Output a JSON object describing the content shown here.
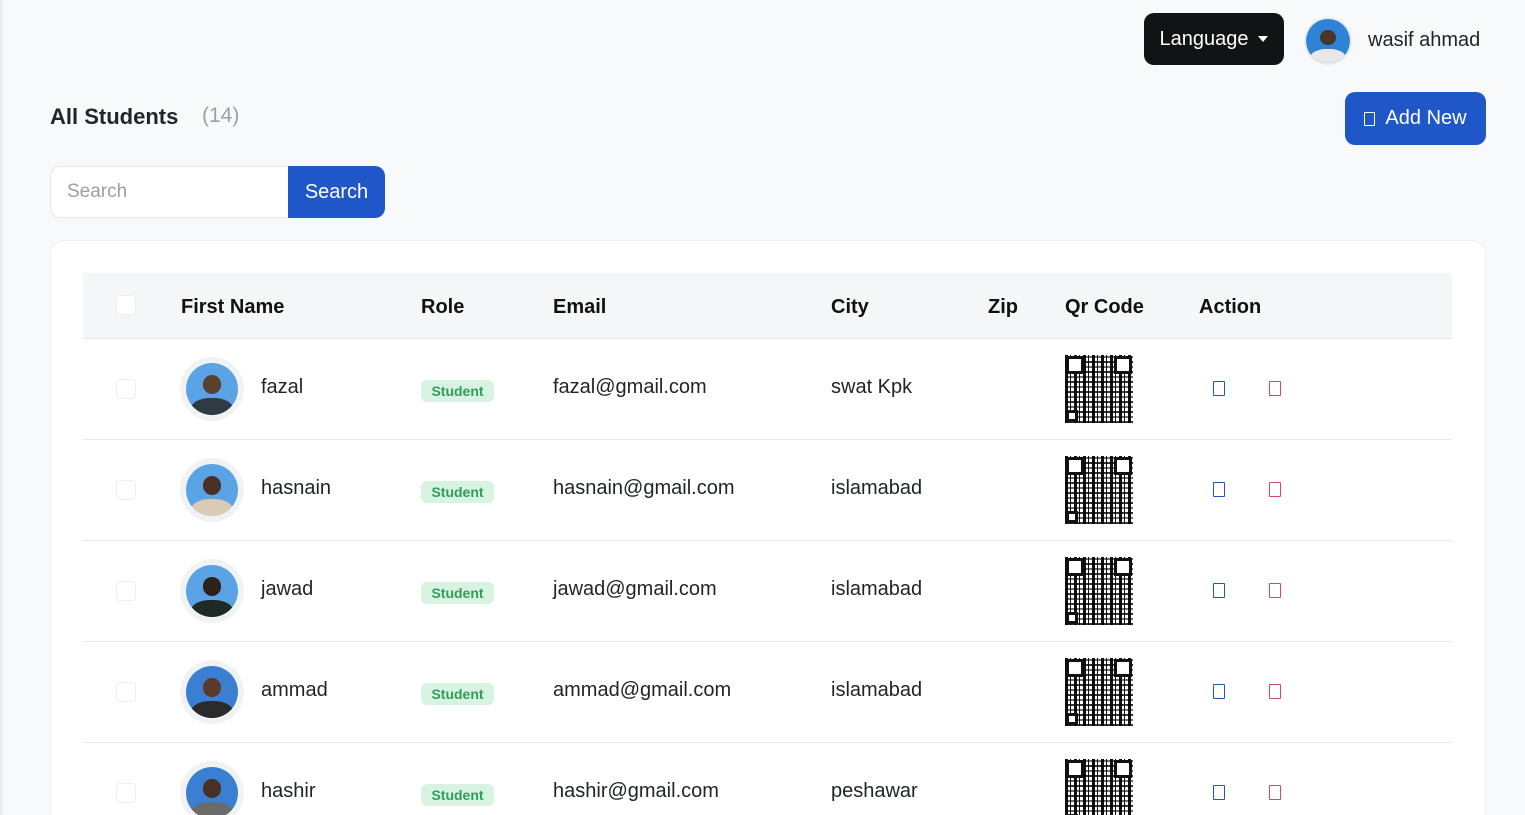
{
  "topbar": {
    "language_label": "Language",
    "user_name": "wasif ahmad"
  },
  "header": {
    "title": "All Students",
    "count": "(14)",
    "add_new_label": "Add New"
  },
  "search": {
    "placeholder": "Search",
    "value": "",
    "button_label": "Search"
  },
  "table": {
    "columns": [
      "First Name",
      "Role",
      "Email",
      "City",
      "Zip",
      "Qr Code",
      "Action"
    ],
    "rows": [
      {
        "first_name": "fazal",
        "role": "Student",
        "email": "fazal@gmail.com",
        "city": "swat Kpk",
        "zip": ""
      },
      {
        "first_name": "hasnain",
        "role": "Student",
        "email": "hasnain@gmail.com",
        "city": "islamabad",
        "zip": ""
      },
      {
        "first_name": "jawad",
        "role": "Student",
        "email": "jawad@gmail.com",
        "city": "islamabad",
        "zip": ""
      },
      {
        "first_name": "ammad",
        "role": "Student",
        "email": "ammad@gmail.com",
        "city": "islamabad",
        "zip": ""
      },
      {
        "first_name": "hashir",
        "role": "Student",
        "email": "hashir@gmail.com",
        "city": "peshawar",
        "zip": ""
      }
    ]
  },
  "colors": {
    "primary": "#1f57c9",
    "dark_button": "#111315",
    "badge_bg": "#d8f3e2",
    "badge_text": "#2f9e58",
    "delete": "#e0475b"
  },
  "icons": {
    "caret": "chevron-down-icon",
    "add": "plus-icon",
    "edit": "edit-icon",
    "delete": "delete-icon"
  }
}
